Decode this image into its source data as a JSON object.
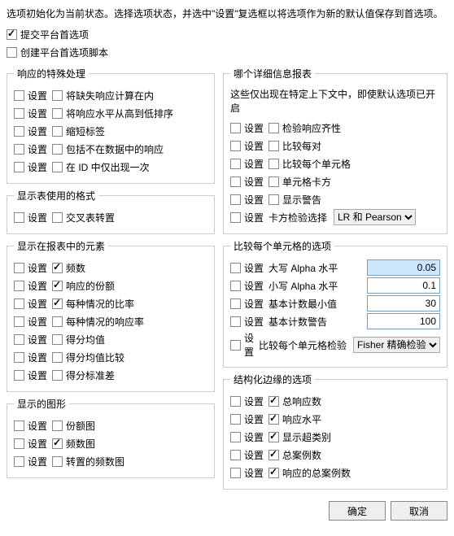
{
  "intro": "选项初始化为当前状态。选择选项状态，并选中\"设置\"复选框以将选项作为新的默认值保存到首选项。",
  "top": {
    "submit": {
      "label": "提交平台首选项",
      "checked": true
    },
    "create": {
      "label": "创建平台首选项脚本",
      "checked": false
    }
  },
  "set_label": "设置",
  "groups": {
    "special": {
      "legend": "响应的特殊处理",
      "items": [
        {
          "label": "将缺失响应计算在内",
          "set": false,
          "val": false
        },
        {
          "label": "将响应水平从高到低排序",
          "set": false,
          "val": false
        },
        {
          "label": "缩短标签",
          "set": false,
          "val": false
        },
        {
          "label": "包括不在数据中的响应",
          "set": false,
          "val": false
        },
        {
          "label": "在 ID 中仅出现一次",
          "set": false,
          "val": false
        }
      ]
    },
    "table_fmt": {
      "legend": "显示表使用的格式",
      "items": [
        {
          "label": "交叉表转置",
          "set": false,
          "val": false
        }
      ]
    },
    "elements": {
      "legend": "显示在报表中的元素",
      "items": [
        {
          "label": "频数",
          "set": false,
          "val": true
        },
        {
          "label": "响应的份额",
          "set": false,
          "val": true
        },
        {
          "label": "每种情况的比率",
          "set": false,
          "val": true
        },
        {
          "label": "每种情况的响应率",
          "set": false,
          "val": false
        },
        {
          "label": "得分均值",
          "set": false,
          "val": false
        },
        {
          "label": "得分均值比较",
          "set": false,
          "val": false
        },
        {
          "label": "得分标准差",
          "set": false,
          "val": false
        }
      ]
    },
    "graphs": {
      "legend": "显示的图形",
      "items": [
        {
          "label": "份额图",
          "set": false,
          "val": false
        },
        {
          "label": "频数图",
          "set": false,
          "val": true
        },
        {
          "label": "转置的频数图",
          "set": false,
          "val": false
        }
      ]
    },
    "detail": {
      "legend": "哪个详细信息报表",
      "hint": "这些仅出现在特定上下文中，即使默认选项已开启",
      "items": [
        {
          "label": "检验响应齐性",
          "set": false,
          "val": false
        },
        {
          "label": "比较每对",
          "set": false,
          "val": false
        },
        {
          "label": "比较每个单元格",
          "set": false,
          "val": false
        },
        {
          "label": "单元格卡方",
          "set": false,
          "val": false
        },
        {
          "label": "显示警告",
          "set": false,
          "val": false
        }
      ],
      "chi": {
        "label": "卡方检验选择",
        "set": false,
        "options": [
          "LR 和 Pearson"
        ],
        "selected": "LR 和 Pearson"
      }
    },
    "cell": {
      "legend": "比较每个单元格的选项",
      "inputs": [
        {
          "label": "大写 Alpha 水平",
          "set": false,
          "value": "0.05",
          "hl": true
        },
        {
          "label": "小写 Alpha 水平",
          "set": false,
          "value": "0.1"
        },
        {
          "label": "基本计数最小值",
          "set": false,
          "value": "30"
        },
        {
          "label": "基本计数警告",
          "set": false,
          "value": "100"
        }
      ],
      "test": {
        "label": "比较每个单元格检验",
        "set": false,
        "options": [
          "Fisher 精确检验"
        ],
        "selected": "Fisher 精确检验"
      }
    },
    "struct": {
      "legend": "结构化边缘的选项",
      "items": [
        {
          "label": "总响应数",
          "set": false,
          "val": true
        },
        {
          "label": "响应水平",
          "set": false,
          "val": true
        },
        {
          "label": "显示超类别",
          "set": false,
          "val": true
        },
        {
          "label": "总案例数",
          "set": false,
          "val": true
        },
        {
          "label": "响应的总案例数",
          "set": false,
          "val": true
        }
      ]
    }
  },
  "buttons": {
    "ok": "确定",
    "cancel": "取消"
  }
}
